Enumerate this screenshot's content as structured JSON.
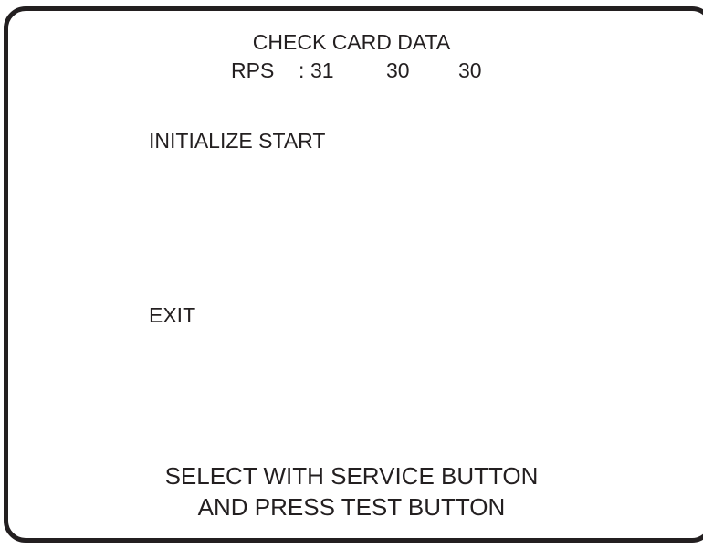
{
  "screen": {
    "title": "CHECK CARD DATA",
    "rps": {
      "label": "RPS",
      "colon": ":",
      "values": [
        "31",
        "30",
        "30"
      ]
    },
    "menu": {
      "items": [
        {
          "label": "INITIALIZE START"
        },
        {
          "label": "EXIT"
        }
      ]
    },
    "footer": {
      "line1": "SELECT WITH SERVICE BUTTON",
      "line2": "AND PRESS TEST BUTTON"
    }
  },
  "colors": {
    "foreground": "#231f20",
    "background": "#ffffff"
  }
}
